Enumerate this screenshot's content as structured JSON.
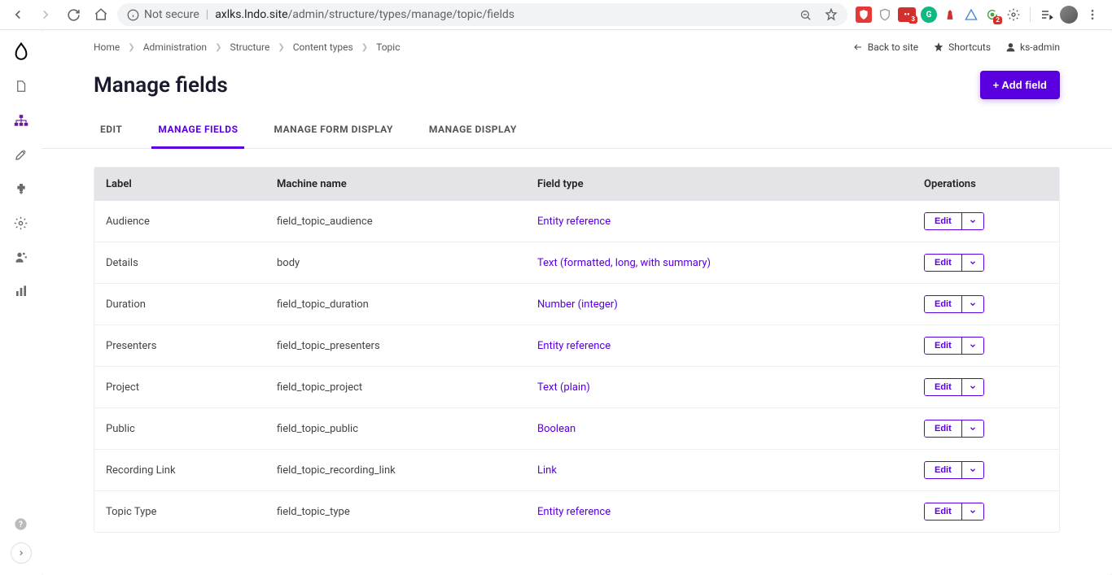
{
  "browser": {
    "url_host": "axlks.lndo.site",
    "url_path": "/admin/structure/types/manage/topic/fields",
    "not_secure": "Not secure",
    "ext_badge_1": "3",
    "ext_badge_2": "2"
  },
  "breadcrumbs": [
    "Home",
    "Administration",
    "Structure",
    "Content types",
    "Topic"
  ],
  "util": {
    "back": "Back to site",
    "shortcuts": "Shortcuts",
    "user": "ks-admin"
  },
  "title": "Manage fields",
  "add_button": "+ Add field",
  "tabs": [
    "EDIT",
    "MANAGE FIELDS",
    "MANAGE FORM DISPLAY",
    "MANAGE DISPLAY"
  ],
  "active_tab": 1,
  "columns": {
    "label": "Label",
    "machine": "Machine name",
    "type": "Field type",
    "ops": "Operations"
  },
  "edit_label": "Edit",
  "rows": [
    {
      "label": "Audience",
      "machine": "field_topic_audience",
      "type": "Entity reference"
    },
    {
      "label": "Details",
      "machine": "body",
      "type": "Text (formatted, long, with summary)"
    },
    {
      "label": "Duration",
      "machine": "field_topic_duration",
      "type": "Number (integer)"
    },
    {
      "label": "Presenters",
      "machine": "field_topic_presenters",
      "type": "Entity reference"
    },
    {
      "label": "Project",
      "machine": "field_topic_project",
      "type": "Text (plain)"
    },
    {
      "label": "Public",
      "machine": "field_topic_public",
      "type": "Boolean"
    },
    {
      "label": "Recording Link",
      "machine": "field_topic_recording_link",
      "type": "Link"
    },
    {
      "label": "Topic Type",
      "machine": "field_topic_type",
      "type": "Entity reference"
    }
  ]
}
